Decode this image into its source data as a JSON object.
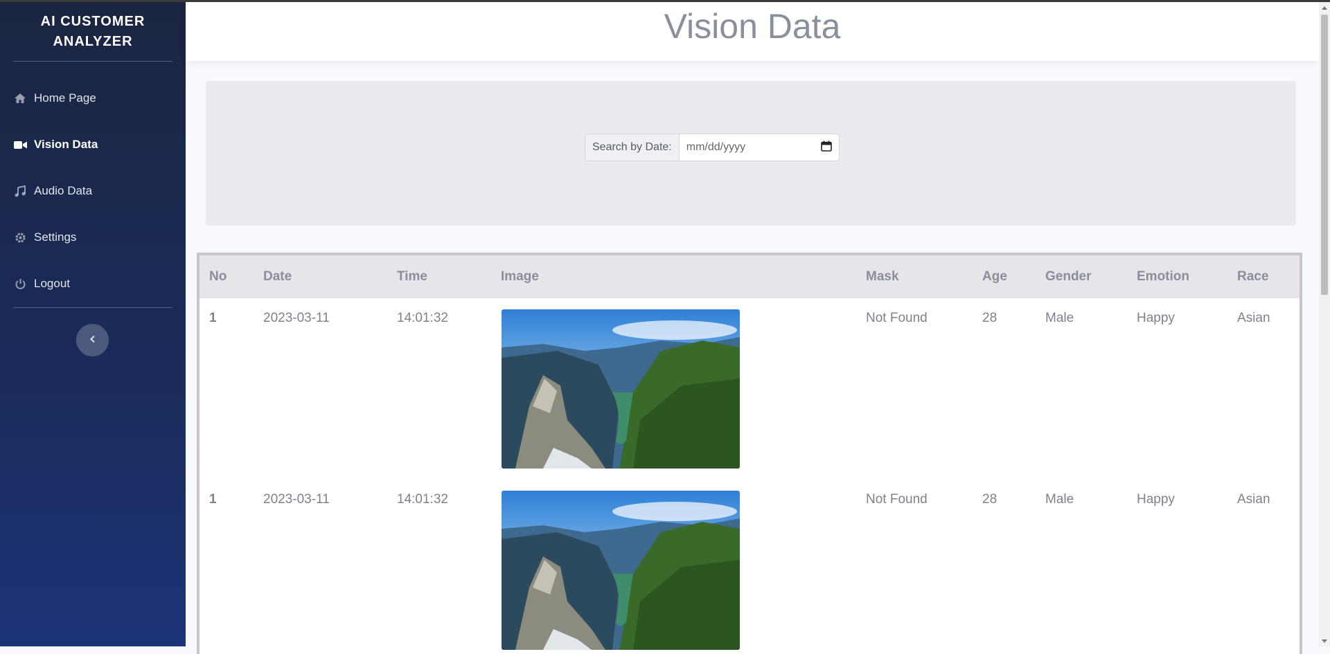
{
  "app": {
    "title_line1": "AI CUSTOMER",
    "title_line2": "ANALYZER"
  },
  "sidebar": {
    "items": [
      {
        "label": "Home Page",
        "icon": "home-icon",
        "active": false
      },
      {
        "label": "Vision Data",
        "icon": "video-camera-icon",
        "active": true
      },
      {
        "label": "Audio Data",
        "icon": "music-note-icon",
        "active": false
      },
      {
        "label": "Settings",
        "icon": "gear-icon",
        "active": false
      },
      {
        "label": "Logout",
        "icon": "power-icon",
        "active": false
      }
    ],
    "toggle_icon": "chevron-left-icon"
  },
  "header": {
    "title": "Vision Data"
  },
  "search": {
    "label": "Search by Date:",
    "placeholder": "mm/dd/yyyy",
    "icon": "calendar-icon"
  },
  "table": {
    "headers": [
      "No",
      "Date",
      "Time",
      "Image",
      "Mask",
      "Age",
      "Gender",
      "Emotion",
      "Race"
    ],
    "rows": [
      {
        "no": "1",
        "date": "2023-03-11",
        "time": "14:01:32",
        "image": "mountain-fjord-photo",
        "mask": "Not Found",
        "age": "28",
        "gender": "Male",
        "emotion": "Happy",
        "race": "Asian"
      },
      {
        "no": "1",
        "date": "2023-03-11",
        "time": "14:01:32",
        "image": "mountain-fjord-photo",
        "mask": "Not Found",
        "age": "28",
        "gender": "Male",
        "emotion": "Happy",
        "race": "Asian"
      }
    ]
  },
  "colors": {
    "sidebar_top": "#1a2540",
    "sidebar_bottom": "#1d3378",
    "title_gray": "#8a8f9c"
  }
}
